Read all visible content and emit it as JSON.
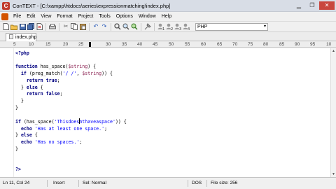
{
  "window": {
    "title": "ConTEXT - [C:\\xampp\\htdocs\\series\\expressionmatching\\index.php]",
    "minimize_glyph": "▁",
    "restore_glyph": "❐",
    "close_glyph": "✕"
  },
  "menu": {
    "items": [
      "File",
      "Edit",
      "View",
      "Format",
      "Project",
      "Tools",
      "Options",
      "Window",
      "Help"
    ]
  },
  "toolbar": {
    "highlighter_value": "PHP",
    "highlighter_arrow": "▾",
    "icons": [
      "new-file-icon",
      "open-folder-icon",
      "save-icon",
      "save-all-icon",
      "close-file-icon",
      "print-icon",
      "cut-icon",
      "copy-icon",
      "paste-icon",
      "undo-icon",
      "redo-icon",
      "find-icon",
      "find-next-icon",
      "replace-icon",
      "tools-icon",
      "user-tool-1-icon",
      "user-tool-2-icon",
      "user-tool-3-icon",
      "user-tool-4-icon"
    ]
  },
  "tabs": [
    {
      "label": "index.php",
      "active": true
    }
  ],
  "ruler": {
    "labels": [
      "5",
      "10",
      "15",
      "20",
      "25",
      "30",
      "35",
      "40",
      "45",
      "50",
      "55",
      "60",
      "65",
      "70",
      "75",
      "80",
      "85",
      "90",
      "95",
      "10"
    ]
  },
  "editor": {
    "language": "PHP"
  },
  "statusbar": {
    "position": "Ln 11, Col 24",
    "insert_mode": "Insert",
    "selection_mode": "Sel: Normal",
    "line_endings": "DOS",
    "file_size": "File size: 256"
  },
  "colors": {
    "keyword": "#000080",
    "variable": "#8b2252",
    "string": "#0000ff",
    "close_button": "#c9463d"
  }
}
